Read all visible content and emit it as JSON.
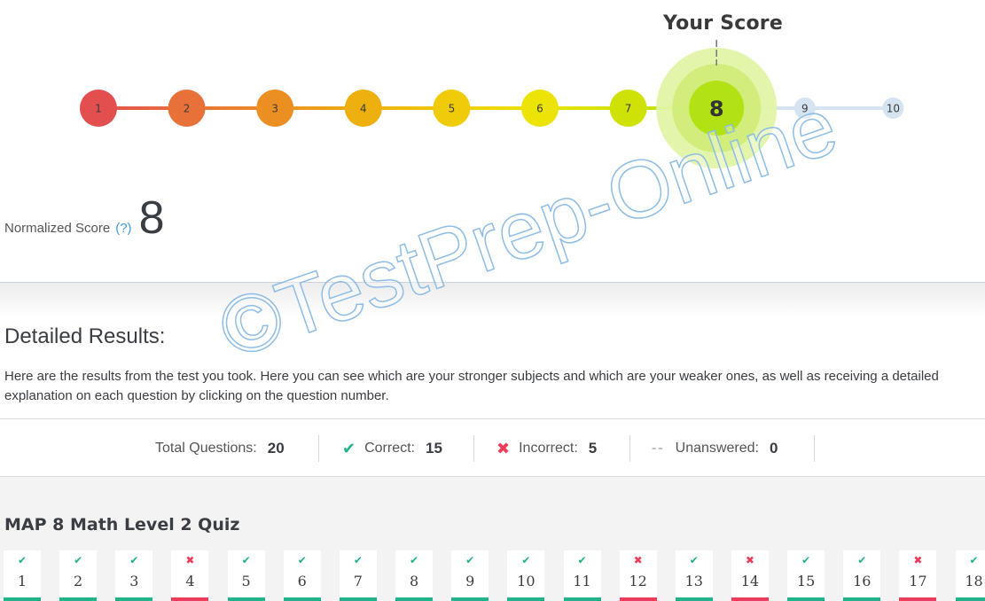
{
  "score_scale": {
    "your_score_label": "Your Score",
    "current": 8,
    "steps": [
      {
        "label": "1",
        "color": "#e34f4f"
      },
      {
        "label": "2",
        "color": "#e8713a"
      },
      {
        "label": "3",
        "color": "#eb8f22"
      },
      {
        "label": "4",
        "color": "#edb00e"
      },
      {
        "label": "5",
        "color": "#f0cb08"
      },
      {
        "label": "6",
        "color": "#ece407"
      },
      {
        "label": "7",
        "color": "#cfe207"
      },
      {
        "label": "8",
        "color": "#b2e214"
      },
      {
        "label": "9",
        "color": "#d6e3f0"
      },
      {
        "label": "10",
        "color": "#d6e3f0"
      }
    ],
    "inactive_line_color": "#d6e3f0",
    "halo_colors": [
      "#e2f4a6",
      "#cdeb70"
    ]
  },
  "normalized_score": {
    "label": "Normalized Score",
    "help_link": "(?)",
    "value": "8"
  },
  "detailed_results": {
    "title": "Detailed Results:",
    "description": "Here are the results from the test you took. Here you can see which are your stronger subjects and which are your weaker ones, as well as receiving a detailed explanation on each question by clicking on the question number."
  },
  "summary": {
    "total_label": "Total Questions:",
    "total_value": "20",
    "correct_label": "Correct:",
    "correct_value": "15",
    "incorrect_label": "Incorrect:",
    "incorrect_value": "5",
    "unanswered_label": "Unanswered:",
    "unanswered_value": "0",
    "icons": {
      "correct": "✔",
      "incorrect": "✖",
      "unanswered": "--"
    }
  },
  "quiz": {
    "title": "MAP 8 Math Level 2 Quiz",
    "questions": [
      {
        "number": "1",
        "status": "correct"
      },
      {
        "number": "2",
        "status": "correct"
      },
      {
        "number": "3",
        "status": "correct"
      },
      {
        "number": "4",
        "status": "incorrect"
      },
      {
        "number": "5",
        "status": "correct"
      },
      {
        "number": "6",
        "status": "correct"
      },
      {
        "number": "7",
        "status": "correct"
      },
      {
        "number": "8",
        "status": "correct"
      },
      {
        "number": "9",
        "status": "correct"
      },
      {
        "number": "10",
        "status": "correct"
      },
      {
        "number": "11",
        "status": "correct"
      },
      {
        "number": "12",
        "status": "incorrect"
      },
      {
        "number": "13",
        "status": "correct"
      },
      {
        "number": "14",
        "status": "incorrect"
      },
      {
        "number": "15",
        "status": "correct"
      },
      {
        "number": "16",
        "status": "correct"
      },
      {
        "number": "17",
        "status": "incorrect"
      },
      {
        "number": "18",
        "status": "correct"
      }
    ]
  },
  "colors": {
    "correct": "#22b38a",
    "incorrect": "#ef3b5a",
    "link": "#3d9be0"
  },
  "watermark": {
    "text": "©TestPrep-Online"
  }
}
